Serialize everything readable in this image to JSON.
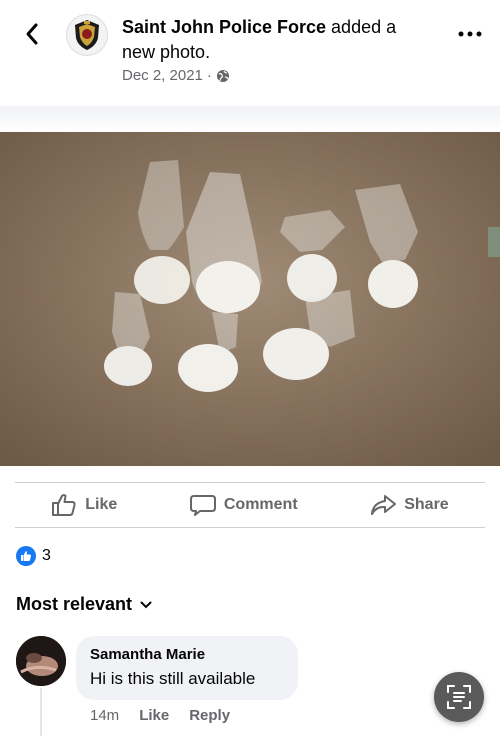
{
  "post": {
    "page_name": "Saint John Police Force",
    "action_text": " added a new photo.",
    "date": "Dec 2, 2021",
    "separator": "·",
    "privacy_icon": "globe-icon"
  },
  "actions": {
    "like_label": "Like",
    "comment_label": "Comment",
    "share_label": "Share"
  },
  "reactions": {
    "count": "3",
    "icon": "thumbs-up-icon",
    "color": "#1877f2"
  },
  "comments_section": {
    "sort_label": "Most relevant",
    "items": [
      {
        "author": "Samantha Marie",
        "text": "Hi is this still available",
        "time": "14m",
        "like_label": "Like",
        "reply_label": "Reply"
      }
    ]
  },
  "colors": {
    "muted_text": "#65676b",
    "bubble_bg": "#f0f2f5",
    "photo_background": "#8b7560",
    "brand_blue": "#1877f2"
  }
}
